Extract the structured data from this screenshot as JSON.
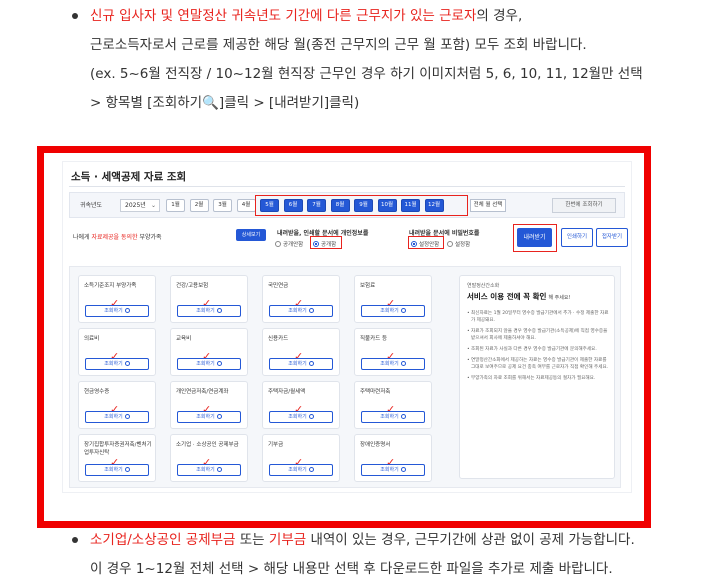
{
  "top_bullet": {
    "line1": {
      "seg_red1": "신규 입사자 및 연말정산 귀속년도 기간에 다른 근무지가 있는 근로자",
      "seg_rest": "의 경우,"
    },
    "line2": "근로소득자로서 근로를 제공한 해당 월(종전 근무지의 근무 월 포함) 모두 조회 바랍니다.",
    "line3": "(ex. 5~6월 전직장 / 10~12월 현직장 근무인 경우 하기 이미지처럼 5, 6, 10, 11, 12월만 선택",
    "line4_pre": "> 항목별 [조회하기",
    "line4_icon": "🔍",
    "line4_post": "]클릭 > [내려받기]클릭)"
  },
  "screenshot": {
    "title": "소득 · 세액공제 자료 조회",
    "filter": {
      "year_label": "귀속년도",
      "year_value": "2025년",
      "months": [
        "1월",
        "2월",
        "3월",
        "4월",
        "5월",
        "6월",
        "7월",
        "8월",
        "9월",
        "10월",
        "11월",
        "12월"
      ],
      "selected_months": [
        "5월",
        "6월",
        "7월",
        "8월",
        "9월",
        "10월",
        "11월",
        "12월"
      ],
      "all_select": "전체 월 선택",
      "bulk_query": "한번에 조회하기"
    },
    "consent": {
      "pre": "나에게 ",
      "highlight": "자료제공을 동의한",
      "post": " 부양가족",
      "detail_btn": "상세보기"
    },
    "print_opts": {
      "title": "내려받을, 인쇄할 문서에 개인정보를",
      "opt1": "공개안함",
      "opt2": "공개함"
    },
    "password_opts": {
      "title": "내려받을 문서에 비밀번호를",
      "opt1": "설정안함",
      "opt2": "설정함"
    },
    "buttons": {
      "download": "내려받기",
      "print": "인쇄하기",
      "forward": "접자받기"
    },
    "cards": [
      {
        "label": "소득기준조지 부양가족",
        "btn": "조회하기",
        "checked": true
      },
      {
        "label": "건강/고용보험",
        "btn": "조회하기",
        "checked": true
      },
      {
        "label": "국민연금",
        "btn": "조회하기",
        "checked": true
      },
      {
        "label": "보험료",
        "btn": "조회하기",
        "checked": true
      },
      {
        "label": "의료비",
        "btn": "조회하기",
        "checked": true
      },
      {
        "label": "교육비",
        "btn": "조회하기",
        "checked": true
      },
      {
        "label": "신용카드",
        "btn": "조회하기",
        "checked": true
      },
      {
        "label": "직불카드 등",
        "btn": "조회하기",
        "checked": true
      },
      {
        "label": "현금영수증",
        "btn": "조회하기",
        "checked": true
      },
      {
        "label": "개인연금저축/연금계좌",
        "btn": "조회하기",
        "checked": true
      },
      {
        "label": "주택자금/월세액",
        "btn": "조회하기",
        "checked": true
      },
      {
        "label": "주택마련저축",
        "btn": "조회하기",
        "checked": true
      },
      {
        "label": "장기집합투자증권저축/벤처기업투자신탁",
        "btn": "조회하기",
        "checked": true
      },
      {
        "label": "소기업 · 소상공인 공제부금",
        "btn": "조회하기",
        "checked": true
      },
      {
        "label": "기부금",
        "btn": "조회하기",
        "checked": true
      },
      {
        "label": "장애인증명서",
        "btn": "조회하기",
        "checked": true
      }
    ],
    "notice": {
      "sub": "연말정산간소화",
      "title": "서비스 이용 전에 꼭 확인",
      "title_small": "해 주세요!",
      "items": [
        "최신자료는 1월 20일부터 영수증 발급기관에서 추가 · 수정 제출한 자료가 제공돼요.",
        "자료가 조회되지 않을 경우 영수증 발급기관(소득공제)에 직접 영수증을 받으셔서 회사에 제출하셔야 해요.",
        "조회된 자료가 사실과 다른 경우 영수증 발급기관에 문의해주세요.",
        "연말정산간소화에서 제공하는 자료는 영수증 발급기관이 제출한 자료를 그대로 보여주므로 공제 요건 충족 여부를 근로자가 직접 확인해 주세요.",
        "부양가족의 자료 조회를 위해서는 자료제공동의 절차가 필요해요."
      ]
    }
  },
  "bottom_bullet": {
    "line1": {
      "seg_red1": "소기업/소상공인 공제부금",
      "seg_mid": " 또는 ",
      "seg_red2": "기부금",
      "seg_rest": " 내역이 있는 경우, 근무기간에 상관 없이 공제 가능합니다."
    },
    "line2": "이 경우 1~12월 전체 선택 > 해당 내용만 선택 후 다운로드한 파일을 추가로 제출 바랍니다."
  },
  "colors": {
    "accent": "#2458d6",
    "highlight_red": "#e8231e",
    "frame_red": "#f00000"
  }
}
